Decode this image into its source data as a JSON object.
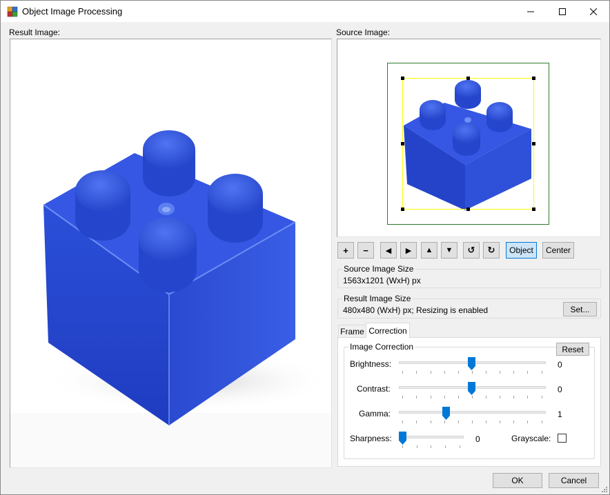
{
  "window": {
    "title": "Object Image Processing",
    "controls": [
      "minimize-icon",
      "maximize-icon",
      "close-icon"
    ]
  },
  "result_panel": {
    "label": "Result Image:"
  },
  "source_panel": {
    "label": "Source Image:"
  },
  "toolbar": {
    "buttons": [
      {
        "name": "zoom-in-button",
        "glyph": "+"
      },
      {
        "name": "zoom-out-button",
        "glyph": "−"
      },
      {
        "name": "move-left-button",
        "glyph": "◀"
      },
      {
        "name": "move-right-button",
        "glyph": "▶"
      },
      {
        "name": "move-up-button",
        "glyph": "▲"
      },
      {
        "name": "move-down-button",
        "glyph": "▼"
      },
      {
        "name": "rotate-ccw-button",
        "glyph": "↺"
      },
      {
        "name": "rotate-cw-button",
        "glyph": "↻"
      }
    ],
    "object_label": "Object",
    "center_label": "Center"
  },
  "source_size": {
    "title": "Source Image Size",
    "value": "1563x1201 (WxH) px"
  },
  "result_size": {
    "title": "Result Image Size",
    "value": "480x480 (WxH) px; Resizing is enabled",
    "set_label": "Set..."
  },
  "tabs": [
    {
      "label": "Frame",
      "selected": false
    },
    {
      "label": "Correction",
      "selected": true
    }
  ],
  "correction": {
    "title": "Image Correction",
    "reset_label": "Reset",
    "brightness": {
      "label": "Brightness:",
      "value": "0"
    },
    "contrast": {
      "label": "Contrast:",
      "value": "0"
    },
    "gamma": {
      "label": "Gamma:",
      "value": "1"
    },
    "sharpness": {
      "label": "Sharpness:",
      "value": "0"
    },
    "grayscale": {
      "label": "Grayscale:",
      "checked": false
    }
  },
  "footer": {
    "ok_label": "OK",
    "cancel_label": "Cancel"
  },
  "colors": {
    "brick": "#2c4fd8",
    "brick_dark": "#1e37a8",
    "brick_light": "#5577ee",
    "slider_thumb": "#0078d7",
    "crop_frame": "#2b7a2b",
    "selection_frame": "#ffff00",
    "active_button": "#cce4f7"
  }
}
